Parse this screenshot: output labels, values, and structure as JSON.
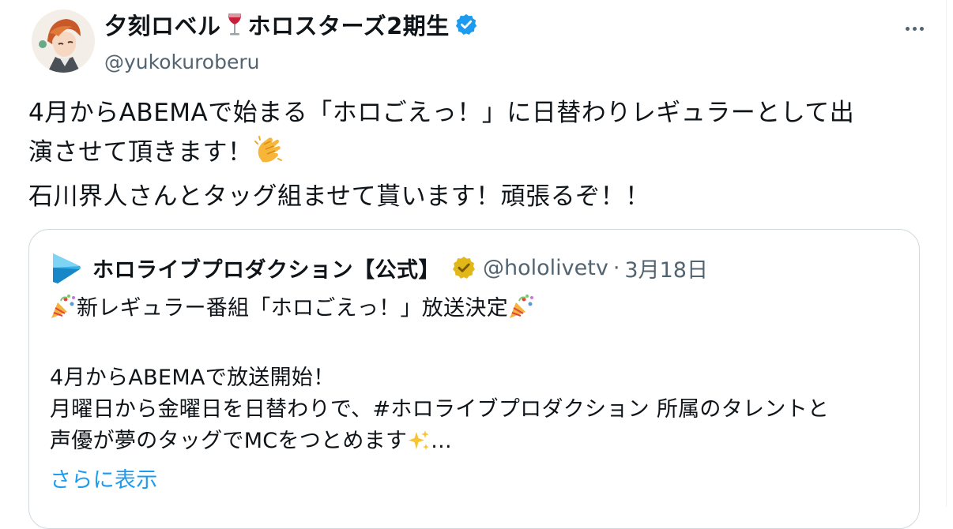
{
  "author": {
    "display_name": "夕刻ロベル",
    "display_name_suffix": "ホロスターズ2期生",
    "handle": "@yukokuroberu"
  },
  "tweet": {
    "lines": [
      "4月からABEMAで始まる「ホロごえっ！」に日替わりレギュラーとして出",
      "演させて頂きます！",
      "石川界人さんとタッグ組ませて貰います！頑張るぞ！！"
    ]
  },
  "quote": {
    "author_name": "ホロライブプロダクション【公式】",
    "handle": "@hololivetv",
    "separator": "·",
    "date": "3月18日",
    "headline": "新レギュラー番組「ホロごえっ！」放送決定",
    "body_lines": [
      "4月からABEMAで放送開始！",
      "月曜日から金曜日を日替わりで、#ホロライブプロダクション 所属のタレントと",
      "声優が夢のタッグでMCをつとめます"
    ],
    "ellipsis": "...",
    "show_more": "さらに表示"
  },
  "icons": {
    "wine": "wine-glass-icon",
    "verified": "blue-verified-badge-icon",
    "more": "more-dots-icon",
    "clap": "clapping-hands-emoji",
    "party": "party-popper-emoji",
    "sparkles": "sparkles-emoji",
    "logo": "play-triangle-logo-icon",
    "gold_badge": "gold-verified-badge-icon"
  },
  "colors": {
    "text": "#0f1419",
    "secondary": "#536471",
    "link": "#1d9bf0",
    "verified_blue": "#1d9bf0",
    "gold": "#e2b719",
    "border": "#cfd9de"
  }
}
